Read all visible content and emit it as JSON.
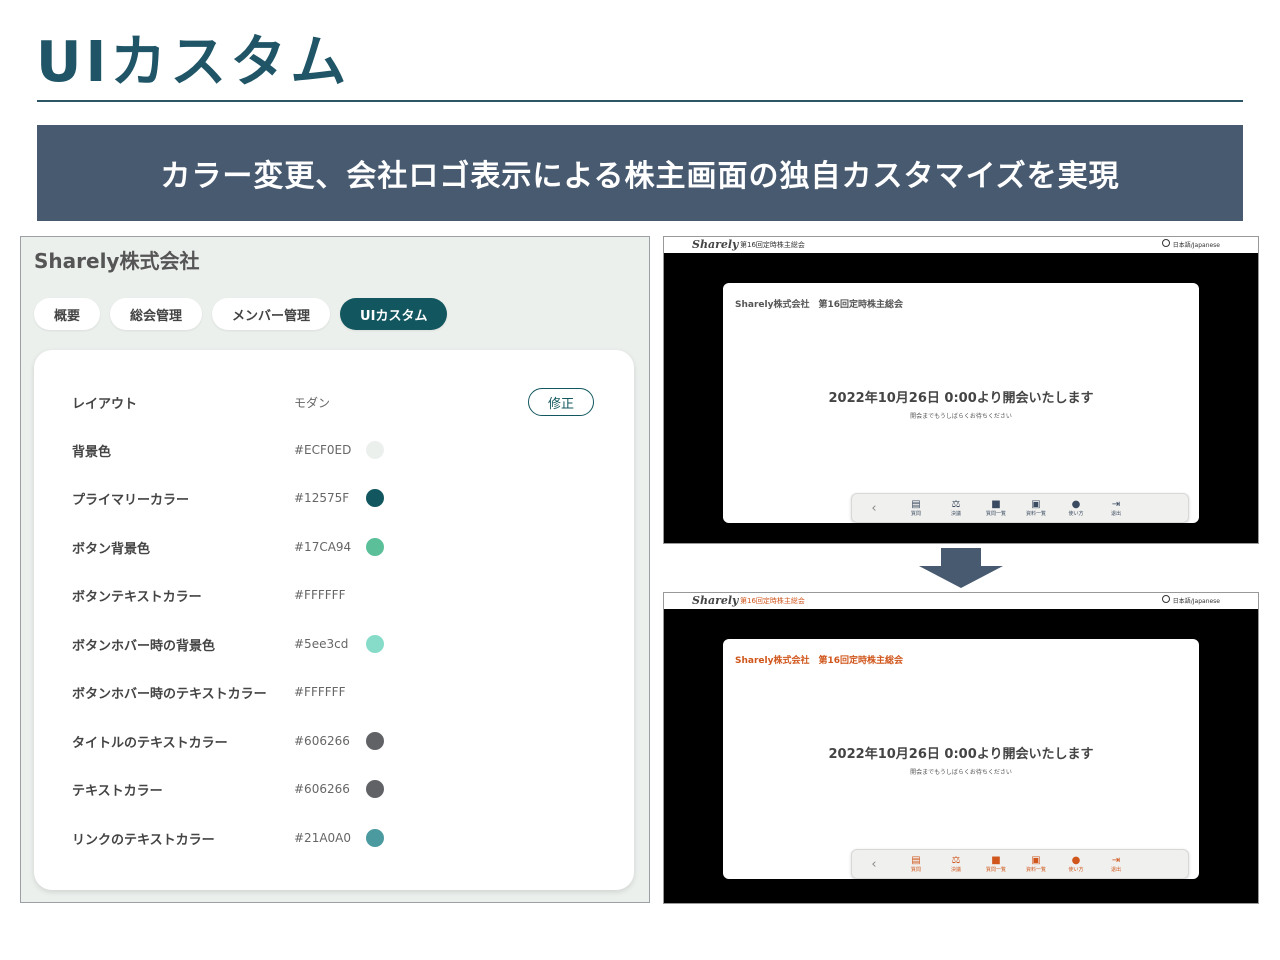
{
  "slide": {
    "title": "UIカスタム",
    "banner": "カラー変更、会社ロゴ表示による株主画面の独自カスタマイズを実現"
  },
  "admin": {
    "company": "Sharely株式会社",
    "tabs": [
      {
        "label": "概要",
        "active": false
      },
      {
        "label": "総会管理",
        "active": false
      },
      {
        "label": "メンバー管理",
        "active": false
      },
      {
        "label": "UIカスタム",
        "active": true
      }
    ],
    "edit_label": "修正",
    "rows": [
      {
        "label": "レイアウト",
        "value": "モダン",
        "swatch": ""
      },
      {
        "label": "背景色",
        "value": "#ECF0ED",
        "swatch": "#ECF0ED"
      },
      {
        "label": "プライマリーカラー",
        "value": "#12575F",
        "swatch": "#12575F"
      },
      {
        "label": "ボタン背景色",
        "value": "#17CA94",
        "swatch": "#5bc09a"
      },
      {
        "label": "ボタンテキストカラー",
        "value": "#FFFFFF",
        "swatch": ""
      },
      {
        "label": "ボタンホバー時の背景色",
        "value": "#5ee3cd",
        "swatch": "#86dcc9"
      },
      {
        "label": "ボタンホバー時のテキストカラー",
        "value": "#FFFFFF",
        "swatch": ""
      },
      {
        "label": "タイトルのテキストカラー",
        "value": "#606266",
        "swatch": "#606266"
      },
      {
        "label": "テキストカラー",
        "value": "#606266",
        "swatch": "#606266"
      },
      {
        "label": "リンクのテキストカラー",
        "value": "#21A0A0",
        "swatch": "#4a9aa0"
      }
    ]
  },
  "screens": [
    {
      "accent": "#555555",
      "icon_color": "#3a4a60",
      "logo": "Sharely",
      "meeting_name": "第16回定時株主総会",
      "language": "日本語/Japanese",
      "card_title": "Sharely株式会社　第16回定時株主総会",
      "open_message": "2022年10月26日 0:00より開会いたします",
      "wait_message": "開会までもうしばらくお待ちください"
    },
    {
      "accent": "#d0561c",
      "icon_color": "#d0561c",
      "logo": "Sharely",
      "meeting_name": "第16回定時株主総会",
      "language": "日本語/Japanese",
      "card_title": "Sharely株式会社　第16回定時株主総会",
      "open_message": "2022年10月26日 0:00より開会いたします",
      "wait_message": "開会までもうしばらくお待ちください"
    }
  ],
  "toolbar": {
    "back": "‹",
    "items": [
      {
        "icon": "question-icon",
        "glyph": "▤",
        "label": "質問"
      },
      {
        "icon": "vote-icon",
        "glyph": "⚖",
        "label": "決議"
      },
      {
        "icon": "question-list-icon",
        "glyph": "■",
        "label": "質問一覧"
      },
      {
        "icon": "documents-icon",
        "glyph": "▣",
        "label": "資料一覧"
      },
      {
        "icon": "info-icon",
        "glyph": "●",
        "label": "使い方"
      },
      {
        "icon": "exit-icon",
        "glyph": "⇥",
        "label": "退出"
      }
    ]
  },
  "arrow": {
    "icon": "arrow-down-icon",
    "color": "#485a70"
  }
}
